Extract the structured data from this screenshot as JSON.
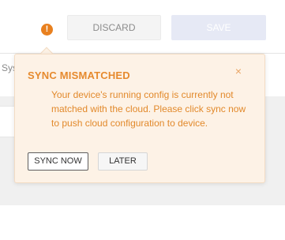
{
  "header": {
    "warning_icon_glyph": "!",
    "discard_label": "DISCARD",
    "save_label": "SAVE"
  },
  "background": {
    "partial_label": "Sys"
  },
  "popover": {
    "title": "SYNC MISMATCHED",
    "close_glyph": "×",
    "message": "Your device's running config is currently not matched with the cloud. Please click sync now to push cloud configuration to device.",
    "sync_now_label": "SYNC NOW",
    "later_label": "LATER"
  },
  "icons": [
    "warning-icon",
    "close-icon"
  ],
  "colors": {
    "warning_accent": "#e68a2e",
    "popover_background": "#fdf2e6",
    "save_disabled": "#e6e9f5"
  }
}
